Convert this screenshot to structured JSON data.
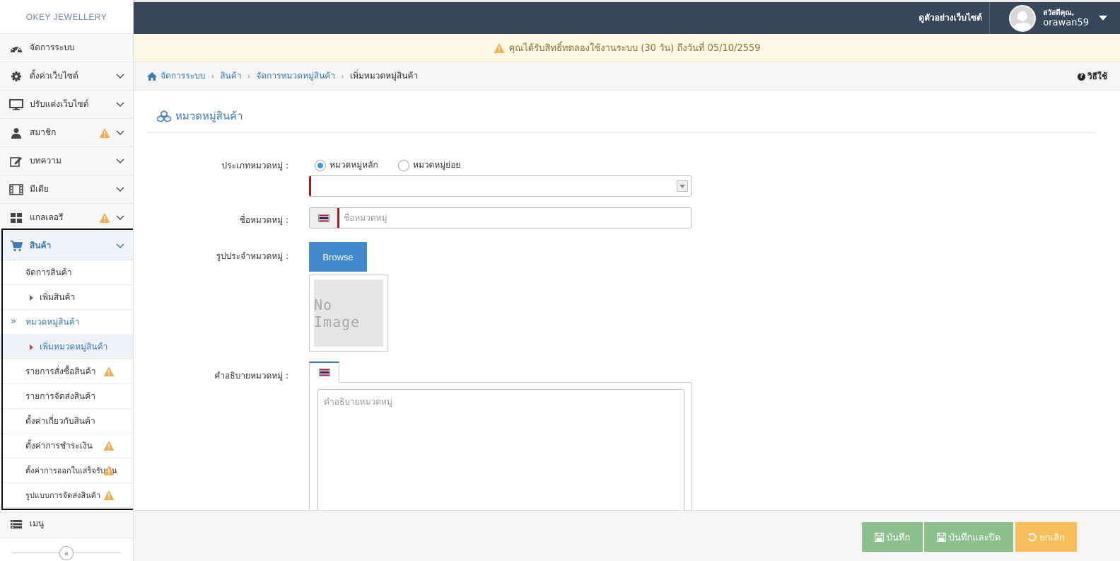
{
  "brand": {
    "logo_text": "OKEY   JEWELLERY"
  },
  "header": {
    "view_site": "ดูตัวอย่างเว็บไซต์",
    "greeting": "สวัสดีคุณ,",
    "username": "orawan59"
  },
  "alert": {
    "text": "คุณได้รับสิทธิ์ทดลองใช้งานระบบ (30 วัน) ถึงวันที่ 05/10/2559"
  },
  "breadcrumb": {
    "items": [
      "จัดการระบบ",
      "สินค้า",
      "จัดการหมวดหมู่สินค้า"
    ],
    "current": "เพิ่มหมวดหมู่สินค้า",
    "help": "วิธีใช้"
  },
  "sidebar": {
    "items": [
      {
        "label": "จัดการระบบ",
        "icon": "dashboard-icon"
      },
      {
        "label": "ตั้งค่าเว็บไซต์",
        "icon": "gear-icon"
      },
      {
        "label": "ปรับแต่งเว็บไซต์",
        "icon": "monitor-icon"
      },
      {
        "label": "สมาชิก",
        "icon": "user-icon",
        "warning": true
      },
      {
        "label": "บทความ",
        "icon": "edit-icon"
      },
      {
        "label": "มีเดีย",
        "icon": "film-icon"
      },
      {
        "label": "แกลเลอรี",
        "icon": "grid-icon",
        "warning": true
      },
      {
        "label": "สินค้า",
        "icon": "cart-icon",
        "active": true
      }
    ],
    "sub_items": [
      "จัดการสินค้า",
      "เพิ่มสินค้า",
      "หมวดหมู่สินค้า",
      "เพิ่มหมวดหมู่สินค้า",
      "รายการสั่งซื้อสินค้า",
      "รายการจัดส่งสินค้า",
      "ตั้งค่าเกี่ยวกับสินค้า",
      "ตั้งค่าการชำระเงิน",
      "ตั้งค่าการออกใบเสร็จรับเงิน",
      "รูปแบบการจัดส่งสินค้า"
    ],
    "menu_label": "เมนู",
    "collapse_glyph": "«"
  },
  "form": {
    "section_title": "หมวดหมู่สินค้า",
    "type_label": "ประเภทหมวดหมู่ :",
    "type_options": [
      "หมวดหมู่หลัก",
      "หมวดหมู่ย่อย"
    ],
    "type_selected": "หมวดหมู่หลัก",
    "name_label": "ชื่อหมวดหมู่ :",
    "name_placeholder": "ชื่อหมวดหมู่",
    "name_value": "",
    "image_label": "รูปประจำหมวดหมู่ :",
    "browse_label": "Browse",
    "no_image_text": "No Image",
    "desc_label": "คำอธิบายหมวดหมู่ :",
    "desc_placeholder": "คำอธิบายหมวดหมู่"
  },
  "footer": {
    "save": "บันทึก",
    "save_close": "บันทึกและปิด",
    "cancel": "ยกเลิก"
  },
  "colors": {
    "header_bg": "#37465a",
    "link_blue": "#3a79b8",
    "warning": "#f0ad4e",
    "save_green": "#8cc08c",
    "cancel_orange": "#f7be5a",
    "required_red": "#b0171f"
  }
}
